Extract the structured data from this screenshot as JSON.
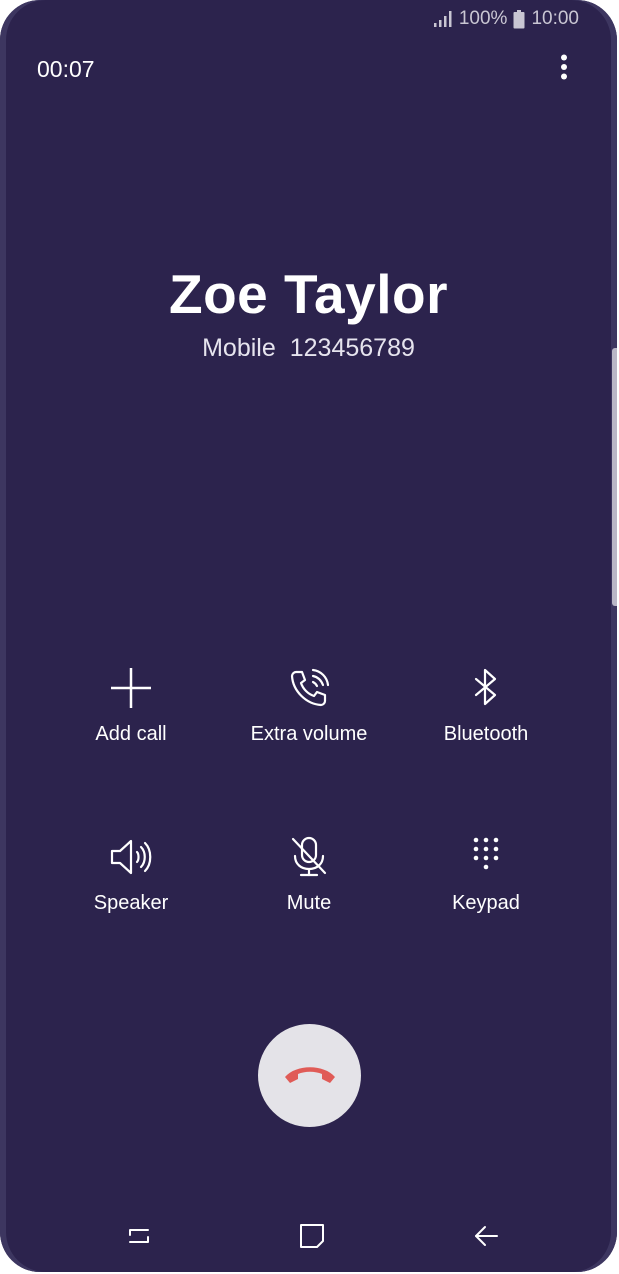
{
  "status_bar": {
    "battery_percent": "100%",
    "time": "10:00",
    "icons": [
      "signal-icon",
      "battery-icon"
    ]
  },
  "call": {
    "duration": "00:07",
    "caller_name": "Zoe Taylor",
    "number_type": "Mobile",
    "number": "123456789"
  },
  "actions": {
    "add_call": "Add call",
    "extra_volume": "Extra volume",
    "bluetooth": "Bluetooth",
    "speaker": "Speaker",
    "mute": "Mute",
    "keypad": "Keypad"
  },
  "colors": {
    "background": "#2c234d",
    "end_call_button": "#e4e3e8",
    "end_call_icon": "#e05b57"
  },
  "icons": {
    "menu": "more-vertical-icon",
    "end_call": "phone-hangup-icon",
    "nav": [
      "recent-apps-icon",
      "home-icon",
      "back-icon"
    ]
  }
}
